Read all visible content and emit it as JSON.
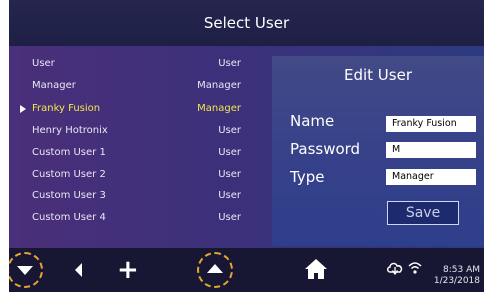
{
  "header": {
    "title": "Select User"
  },
  "users": [
    {
      "name": "User",
      "type": "User",
      "selected": false
    },
    {
      "name": "Manager",
      "type": "Manager",
      "selected": false
    },
    {
      "name": "Franky Fusion",
      "type": "Manager",
      "selected": true
    },
    {
      "name": "Henry Hotronix",
      "type": "User",
      "selected": false
    },
    {
      "name": "Custom User 1",
      "type": "User",
      "selected": false
    },
    {
      "name": "Custom User 2",
      "type": "User",
      "selected": false
    },
    {
      "name": "Custom User 3",
      "type": "User",
      "selected": false
    },
    {
      "name": "Custom User 4",
      "type": "User",
      "selected": false
    }
  ],
  "edit_panel": {
    "title": "Edit User",
    "name_label": "Name",
    "name_value": "Franky Fusion",
    "password_label": "Password",
    "password_value": "M",
    "type_label": "Type",
    "type_value": "Manager",
    "save_label": "Save"
  },
  "status": {
    "time": "8:53 AM",
    "date": "1/23/2018"
  },
  "icons": {
    "scroll_down": "triangle-down",
    "back": "triangle-left",
    "add": "plus",
    "scroll_up": "triangle-up",
    "home": "house",
    "cloud": "cloud-sync",
    "wifi": "wifi"
  },
  "colors": {
    "selected_text": "#f2e64a",
    "highlight_circle": "#e8a531"
  }
}
